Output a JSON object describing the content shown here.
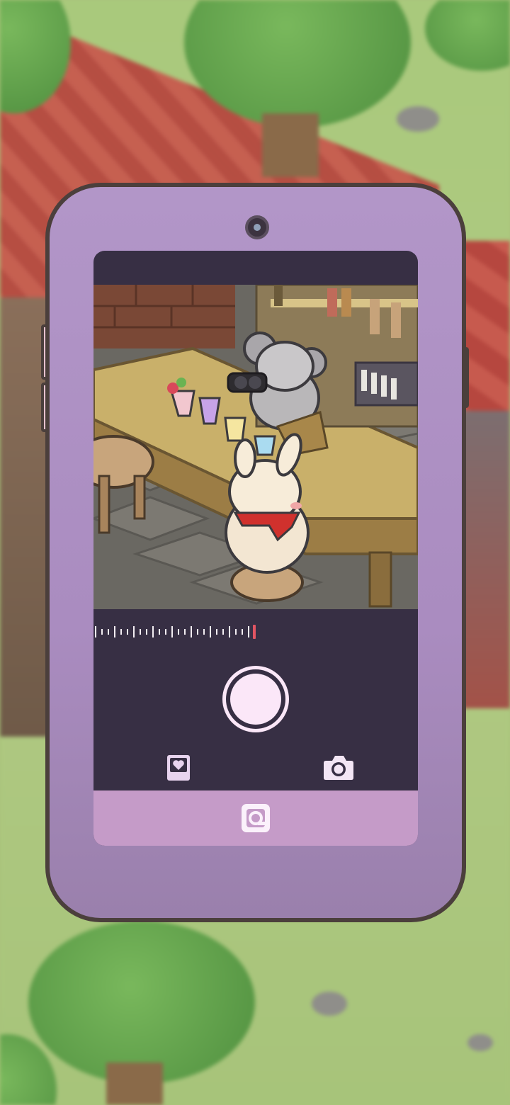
{
  "app": {
    "accent_color": "#fbe7f8",
    "phone_color": "#aa8cc0",
    "screen_color": "#372f44"
  },
  "viewfinder": {
    "scene": "bar-interior"
  },
  "zoom_ruler": {
    "tick_count": 25,
    "marker_color": "#e25563"
  },
  "controls": {
    "shutter_icon": "shutter-button",
    "album_icon": "heart-photo-album-icon",
    "camera_icon": "camera-icon",
    "bottom_icon": "app-menu-icon"
  }
}
